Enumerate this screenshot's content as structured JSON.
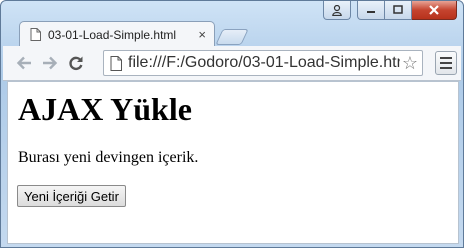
{
  "window": {
    "controls": [
      "user",
      "minimize",
      "maximize",
      "close"
    ]
  },
  "tab": {
    "title": "03-01-Load-Simple.html",
    "close_glyph": "×"
  },
  "toolbar": {
    "back_icon": "back-arrow-icon",
    "forward_icon": "forward-arrow-icon",
    "reload_icon": "reload-icon",
    "url": "file:///F:/Godoro/03-01-Load-Simple.html",
    "star_icon": "star-icon",
    "menu_icon": "menu-icon"
  },
  "page": {
    "heading": "AJAX Yükle",
    "paragraph": "Burası yeni devingen içerik.",
    "button_label": "Yeni İçeriği Getir"
  }
}
